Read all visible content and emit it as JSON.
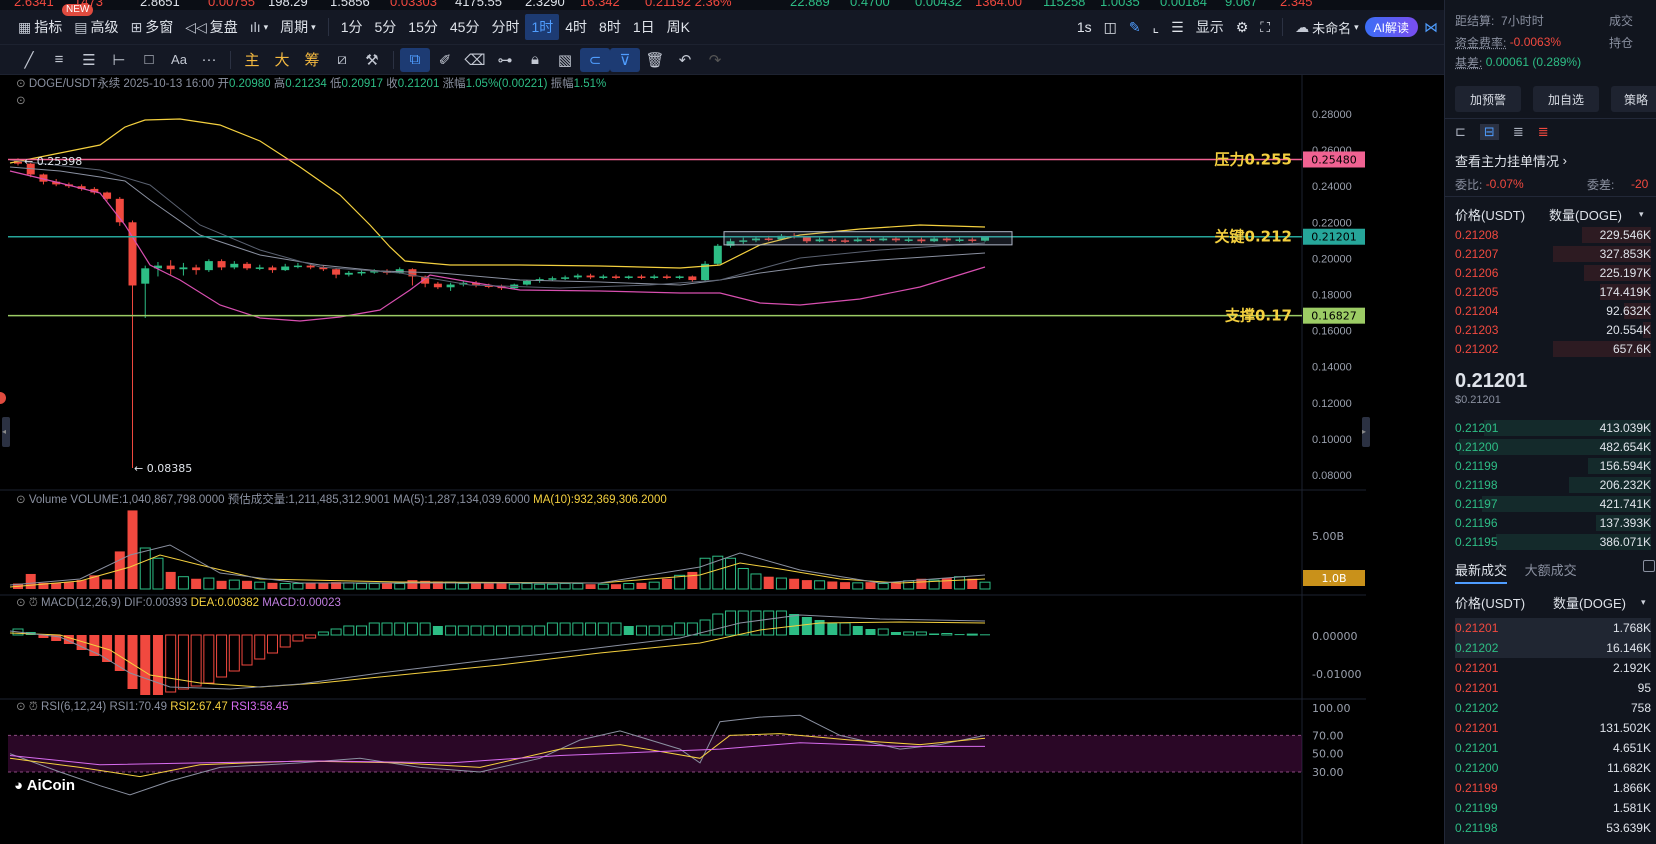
{
  "ticker": [
    {
      "t": "2.6341",
      "c": "#f1493f"
    },
    {
      "t": "1473",
      "c": "#f1493f"
    },
    {
      "t": "2.8651",
      "c": "#dfe3ea"
    },
    {
      "t": "0.00755",
      "c": "#f1493f"
    },
    {
      "t": "198.29",
      "c": "#dfe3ea"
    },
    {
      "t": "1.5856",
      "c": "#dfe3ea"
    },
    {
      "t": "0.03303",
      "c": "#f1493f"
    },
    {
      "t": "4175.55",
      "c": "#dfe3ea"
    },
    {
      "t": "2.3290",
      "c": "#dfe3ea"
    },
    {
      "t": "16.342",
      "c": "#f1493f"
    },
    {
      "t": "0.21192 2.36%",
      "c": "#f1493f"
    },
    {
      "t": "22.889",
      "c": "#2dbd85"
    },
    {
      "t": "0.4700",
      "c": "#2dbd85"
    },
    {
      "t": "0.00432",
      "c": "#2dbd85"
    },
    {
      "t": "1364.00",
      "c": "#f1493f"
    },
    {
      "t": "115258",
      "c": "#2dbd85"
    },
    {
      "t": "1.0035",
      "c": "#2dbd85"
    },
    {
      "t": "0.00184",
      "c": "#2dbd85"
    },
    {
      "t": "9.067",
      "c": "#2dbd85"
    },
    {
      "t": "2.345",
      "c": "#f1493f"
    }
  ],
  "toolbar": {
    "new_badge": "NEW",
    "indicator": "指标",
    "advanced": "高级",
    "multi": "多窗",
    "replay": "复盘",
    "period": "周期",
    "intervals": [
      "1分",
      "5分",
      "15分",
      "45分",
      "分时",
      "1时",
      "4时",
      "8时",
      "1日",
      "周K"
    ],
    "active_interval": "1时",
    "refresh": "1s",
    "display": "显示",
    "unnamed": "未命名",
    "ai": "AI解读"
  },
  "toolbar2": {
    "main": "主",
    "big": "大",
    "chip": "筹"
  },
  "chart": {
    "symbol": "DOGE/USDT永续",
    "time": "2025-10-13 16:00",
    "open_lbl": "开",
    "open": "0.20980",
    "high_lbl": "高",
    "high": "0.21234",
    "low_lbl": "低",
    "low": "0.20917",
    "close_lbl": "收",
    "close": "0.21201",
    "chg_lbl": "涨幅",
    "chg": "1.05%(0.00221)",
    "amp_lbl": "振幅",
    "amp": "1.51%",
    "price_ticks": [
      "0.28000",
      "0.26000",
      "0.24000",
      "0.22000",
      "0.20000",
      "0.18000",
      "0.16000",
      "0.14000",
      "0.12000",
      "0.10000",
      "0.08000"
    ],
    "high_marker": "← 0.25398",
    "low_marker": "← 0.08385",
    "pressure_label": "压力0.255",
    "pressure_tag": "0.25480",
    "key_label": "关键0.212",
    "key_tag": "0.21201",
    "support_label": "支撑0.17",
    "support_tag": "0.16827",
    "volume_info": {
      "name": "Volume",
      "vol": "VOLUME:1,040,867,798.0000",
      "est": "预估成交量:1,211,485,312.9001",
      "ma5": "MA(5):1,287,134,039.6000",
      "ma10": "MA(10):932,369,306.2000"
    },
    "volume_ticks": [
      "5.00B"
    ],
    "volume_tag": "1.0B",
    "macd_info": {
      "name": "MACD(12,26,9)",
      "dif": "DIF:0.00393",
      "dea": "DEA:0.00382",
      "macd": "MACD:0.00023"
    },
    "macd_ticks": [
      "0.00000",
      "-0.01000"
    ],
    "rsi_info": {
      "name": "RSI(6,12,24)",
      "r1": "RSI1:70.49",
      "r2": "RSI2:67.47",
      "r3": "RSI3:58.45"
    },
    "rsi_ticks": [
      "100.00",
      "70.00",
      "50.00",
      "30.00"
    ],
    "logo": "AiCoin"
  },
  "chart_data": {
    "type": "candlestick",
    "symbol": "DOGE/USDT永续",
    "interval": "1时",
    "y_range": [
      0.07,
      0.29
    ],
    "candles": [
      [
        0.2545,
        0.2525,
        0.2555,
        0.2515
      ],
      [
        0.2525,
        0.2465,
        0.253,
        0.245
      ],
      [
        0.2465,
        0.2425,
        0.247,
        0.241
      ],
      [
        0.2425,
        0.241,
        0.244,
        0.24
      ],
      [
        0.241,
        0.24,
        0.242,
        0.239
      ],
      [
        0.24,
        0.2385,
        0.241,
        0.2375
      ],
      [
        0.2385,
        0.2365,
        0.2395,
        0.2355
      ],
      [
        0.2365,
        0.233,
        0.237,
        0.232
      ],
      [
        0.233,
        0.22,
        0.234,
        0.218
      ],
      [
        0.22,
        0.185,
        0.221,
        0.0839
      ],
      [
        0.186,
        0.1945,
        0.196,
        0.167
      ],
      [
        0.1945,
        0.196,
        0.198,
        0.19
      ],
      [
        0.196,
        0.194,
        0.199,
        0.191
      ],
      [
        0.194,
        0.195,
        0.1975,
        0.1905
      ],
      [
        0.195,
        0.1935,
        0.1965,
        0.191
      ],
      [
        0.1935,
        0.1985,
        0.1995,
        0.1925
      ],
      [
        0.1985,
        0.195,
        0.1995,
        0.1935
      ],
      [
        0.195,
        0.197,
        0.1985,
        0.194
      ],
      [
        0.197,
        0.1945,
        0.198,
        0.1935
      ],
      [
        0.1945,
        0.195,
        0.1965,
        0.1935
      ],
      [
        0.195,
        0.1935,
        0.196,
        0.192
      ],
      [
        0.1935,
        0.1955,
        0.197,
        0.193
      ],
      [
        0.1955,
        0.196,
        0.1975,
        0.1945
      ],
      [
        0.196,
        0.195,
        0.197,
        0.194
      ],
      [
        0.195,
        0.194,
        0.196,
        0.193
      ],
      [
        0.194,
        0.191,
        0.1945,
        0.189
      ],
      [
        0.191,
        0.192,
        0.193,
        0.19
      ],
      [
        0.192,
        0.1925,
        0.1935,
        0.1905
      ],
      [
        0.1925,
        0.193,
        0.194,
        0.1915
      ],
      [
        0.193,
        0.192,
        0.194,
        0.191
      ],
      [
        0.192,
        0.194,
        0.195,
        0.1915
      ],
      [
        0.194,
        0.19,
        0.1945,
        0.185
      ],
      [
        0.19,
        0.186,
        0.1905,
        0.184
      ],
      [
        0.186,
        0.184,
        0.187,
        0.183
      ],
      [
        0.184,
        0.1855,
        0.1865,
        0.182
      ],
      [
        0.1855,
        0.1865,
        0.1875,
        0.1845
      ],
      [
        0.1865,
        0.185,
        0.1875,
        0.184
      ],
      [
        0.185,
        0.1845,
        0.186,
        0.1835
      ],
      [
        0.1845,
        0.1835,
        0.1855,
        0.1825
      ],
      [
        0.1835,
        0.1855,
        0.186,
        0.183
      ],
      [
        0.1855,
        0.1875,
        0.188,
        0.185
      ],
      [
        0.1875,
        0.1885,
        0.1895,
        0.1865
      ],
      [
        0.1885,
        0.189,
        0.19,
        0.1875
      ],
      [
        0.189,
        0.1895,
        0.1905,
        0.188
      ],
      [
        0.1895,
        0.1905,
        0.1915,
        0.1885
      ],
      [
        0.1905,
        0.1895,
        0.1915,
        0.1885
      ],
      [
        0.1895,
        0.19,
        0.191,
        0.1885
      ],
      [
        0.19,
        0.1895,
        0.191,
        0.1885
      ],
      [
        0.1895,
        0.19,
        0.1905,
        0.1885
      ],
      [
        0.19,
        0.1895,
        0.191,
        0.1885
      ],
      [
        0.1895,
        0.19,
        0.191,
        0.1885
      ],
      [
        0.19,
        0.1895,
        0.191,
        0.1885
      ],
      [
        0.1895,
        0.19,
        0.1905,
        0.1885
      ],
      [
        0.19,
        0.188,
        0.1905,
        0.187
      ],
      [
        0.188,
        0.197,
        0.1985,
        0.1875
      ],
      [
        0.197,
        0.207,
        0.208,
        0.196
      ],
      [
        0.207,
        0.2095,
        0.211,
        0.206
      ],
      [
        0.2095,
        0.21,
        0.2115,
        0.208
      ],
      [
        0.21,
        0.211,
        0.212,
        0.209
      ],
      [
        0.211,
        0.2105,
        0.2125,
        0.2095
      ],
      [
        0.2105,
        0.2125,
        0.2135,
        0.21
      ],
      [
        0.2125,
        0.212,
        0.214,
        0.211
      ],
      [
        0.212,
        0.2095,
        0.2125,
        0.2085
      ],
      [
        0.2095,
        0.2105,
        0.2115,
        0.209
      ],
      [
        0.2105,
        0.21,
        0.2115,
        0.209
      ],
      [
        0.21,
        0.2095,
        0.211,
        0.2085
      ],
      [
        0.2095,
        0.2105,
        0.2115,
        0.209
      ],
      [
        0.2105,
        0.21,
        0.2115,
        0.209
      ],
      [
        0.21,
        0.211,
        0.212,
        0.2095
      ],
      [
        0.211,
        0.21,
        0.212,
        0.209
      ],
      [
        0.21,
        0.2105,
        0.2115,
        0.209
      ],
      [
        0.2105,
        0.2095,
        0.2115,
        0.2085
      ],
      [
        0.2095,
        0.211,
        0.212,
        0.209
      ],
      [
        0.211,
        0.21,
        0.212,
        0.209
      ],
      [
        0.21,
        0.2105,
        0.2115,
        0.209
      ],
      [
        0.2105,
        0.2098,
        0.2115,
        0.2088
      ],
      [
        0.2098,
        0.212,
        0.2123,
        0.2092
      ]
    ],
    "volumes": [
      0.8,
      2.2,
      0.9,
      0.9,
      1.0,
      1.3,
      2.0,
      1.4,
      5.5,
      11.5,
      6.0,
      4.5,
      2.5,
      1.8,
      1.5,
      1.6,
      1.2,
      1.3,
      1.2,
      1.0,
      0.9,
      0.8,
      0.8,
      0.9,
      0.8,
      1.0,
      0.9,
      0.8,
      0.8,
      0.8,
      0.8,
      1.3,
      1.2,
      1.1,
      1.0,
      0.8,
      0.9,
      0.8,
      0.9,
      0.7,
      0.8,
      0.7,
      0.7,
      0.8,
      0.8,
      0.7,
      0.7,
      0.7,
      0.8,
      0.9,
      1.0,
      1.5,
      2.0,
      2.5,
      4.5,
      4.8,
      4.5,
      3.0,
      2.2,
      1.8,
      1.6,
      1.5,
      1.3,
      1.2,
      1.1,
      1.0,
      0.9,
      1.0,
      0.8,
      1.0,
      1.2,
      1.5,
      1.3,
      1.6,
      1.8,
      1.5,
      1.0
    ],
    "macd_hist": [
      0.002,
      0.001,
      -0.001,
      -0.002,
      -0.003,
      -0.005,
      -0.007,
      -0.009,
      -0.012,
      -0.018,
      -0.02,
      -0.02,
      -0.019,
      -0.018,
      -0.017,
      -0.016,
      -0.014,
      -0.012,
      -0.01,
      -0.008,
      -0.006,
      -0.004,
      -0.002,
      -0.001,
      0.001,
      0.002,
      0.003,
      0.003,
      0.004,
      0.004,
      0.004,
      0.004,
      0.004,
      0.003,
      0.003,
      0.003,
      0.003,
      0.003,
      0.003,
      0.003,
      0.003,
      0.003,
      0.004,
      0.004,
      0.004,
      0.004,
      0.004,
      0.004,
      0.003,
      0.003,
      0.003,
      0.003,
      0.004,
      0.004,
      0.005,
      0.007,
      0.008,
      0.008,
      0.008,
      0.008,
      0.008,
      0.007,
      0.006,
      0.005,
      0.004,
      0.004,
      0.003,
      0.002,
      0.002,
      0.001,
      0.001,
      0.001,
      0.0005,
      0.0005,
      0.0003,
      0.0003,
      0.00023
    ],
    "ma_price_ticks": [
      0.28,
      0.26,
      0.24,
      0.22,
      0.2,
      0.18,
      0.16,
      0.14,
      0.12,
      0.1,
      0.08
    ],
    "levels": {
      "pressure": 0.2548,
      "key": 0.21201,
      "support": 0.16827
    }
  },
  "right": {
    "settle_lbl": "距结算:",
    "settle": "7小时时",
    "settle_right": "成交",
    "fund_lbl": "资金费率:",
    "fund": "-0.0063%",
    "hold": "持仓",
    "basis_lbl": "基差:",
    "basis": "0.00061 (0.289%)",
    "btn_alert": "加预警",
    "btn_fav": "加自选",
    "btn_strategy": "策略",
    "big_orders": "查看主力挂单情况",
    "ratio_lbl": "委比:",
    "ratio": "-0.07%",
    "diff_lbl": "委差:",
    "diff": "-20",
    "ob_price_hdr": "价格(USDT)",
    "ob_qty_hdr": "数量(DOGE)",
    "asks": [
      {
        "p": "0.21208",
        "q": "229.546K",
        "w": 0.35
      },
      {
        "p": "0.21207",
        "q": "327.853K",
        "w": 0.5
      },
      {
        "p": "0.21206",
        "q": "225.197K",
        "w": 0.34
      },
      {
        "p": "0.21205",
        "q": "174.419K",
        "w": 0.26
      },
      {
        "p": "0.21204",
        "q": "92.632K",
        "w": 0.14
      },
      {
        "p": "0.21203",
        "q": "20.554K",
        "w": 0.04
      },
      {
        "p": "0.21202",
        "q": "657.6K",
        "w": 0.5
      }
    ],
    "last": "0.21201",
    "last_usd": "$0.21201",
    "bids": [
      {
        "p": "0.21201",
        "q": "413.039K",
        "w": 0.85
      },
      {
        "p": "0.21200",
        "q": "482.654K",
        "w": 0.98
      },
      {
        "p": "0.21199",
        "q": "156.594K",
        "w": 0.32
      },
      {
        "p": "0.21198",
        "q": "206.232K",
        "w": 0.42
      },
      {
        "p": "0.21197",
        "q": "421.741K",
        "w": 0.86
      },
      {
        "p": "0.21196",
        "q": "137.393K",
        "w": 0.28
      },
      {
        "p": "0.21195",
        "q": "386.071K",
        "w": 0.79
      }
    ],
    "trade_tab1": "最新成交",
    "trade_tab2": "大额成交",
    "trades": [
      {
        "p": "0.21201",
        "q": "1.768K",
        "c": "red"
      },
      {
        "p": "0.21202",
        "q": "16.146K",
        "c": "green"
      },
      {
        "p": "0.21201",
        "q": "2.192K",
        "c": "red"
      },
      {
        "p": "0.21201",
        "q": "95",
        "c": "red"
      },
      {
        "p": "0.21202",
        "q": "758",
        "c": "green"
      },
      {
        "p": "0.21201",
        "q": "131.502K",
        "c": "red"
      },
      {
        "p": "0.21201",
        "q": "4.651K",
        "c": "green"
      },
      {
        "p": "0.21200",
        "q": "11.682K",
        "c": "green"
      },
      {
        "p": "0.21199",
        "q": "1.866K",
        "c": "red"
      },
      {
        "p": "0.21199",
        "q": "1.581K",
        "c": "green"
      },
      {
        "p": "0.21198",
        "q": "53.639K",
        "c": "green"
      }
    ]
  }
}
